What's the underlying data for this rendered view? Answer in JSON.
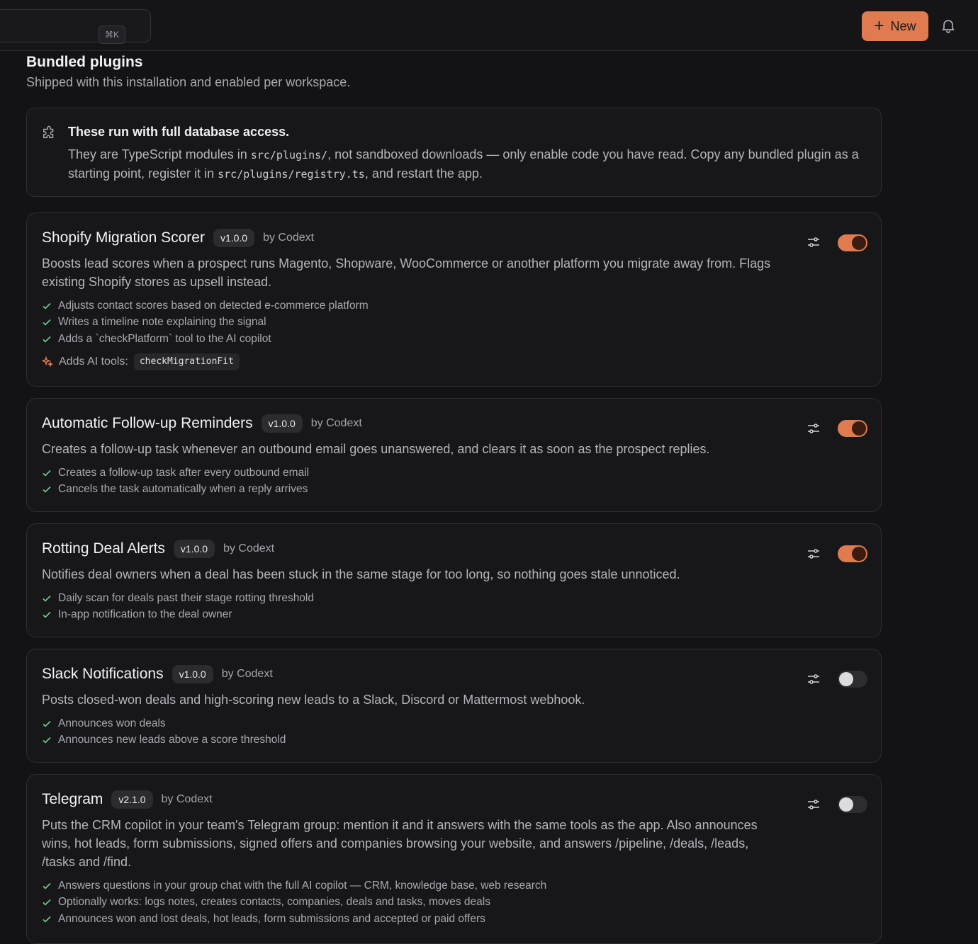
{
  "header": {
    "search_shortcut": "⌘K",
    "new_button_label": "New",
    "new_button_icon": "plus-icon",
    "notification_icon": "bell-icon",
    "accent_color": "#e07a4f"
  },
  "section": {
    "title": "Bundled plugins",
    "subtitle": "Shipped with this installation and enabled per workspace."
  },
  "notice": {
    "icon": "puzzle-icon",
    "title": "These run with full database access.",
    "body_1": "They are TypeScript modules in ",
    "code_1": "src/plugins/",
    "body_2": ", not sandboxed downloads — only enable code you have read. Copy any bundled plugin as a starting point, register it in ",
    "code_2": "src/plugins/registry.ts",
    "body_3": ", and restart the app."
  },
  "plugins": [
    {
      "name": "Shopify Migration Scorer",
      "version": "v1.0.0",
      "author": "by Codext",
      "enabled": true,
      "description": "Boosts lead scores when a prospect runs Magento, Shopware, WooCommerce or another platform you migrate away from. Flags existing Shopify stores as upsell instead.",
      "features": [
        "Adjusts contact scores based on detected e-commerce platform",
        "Writes a timeline note explaining the signal",
        "Adds a `checkPlatform` tool to the AI copilot"
      ],
      "tools_label": "Adds AI tools:",
      "tools": [
        "checkMigrationFit"
      ]
    },
    {
      "name": "Automatic Follow-up Reminders",
      "version": "v1.0.0",
      "author": "by Codext",
      "enabled": true,
      "description": "Creates a follow-up task whenever an outbound email goes unanswered, and clears it as soon as the prospect replies.",
      "features": [
        "Creates a follow-up task after every outbound email",
        "Cancels the task automatically when a reply arrives"
      ]
    },
    {
      "name": "Rotting Deal Alerts",
      "version": "v1.0.0",
      "author": "by Codext",
      "enabled": true,
      "description": "Notifies deal owners when a deal has been stuck in the same stage for too long, so nothing goes stale unnoticed.",
      "features": [
        "Daily scan for deals past their stage rotting threshold",
        "In-app notification to the deal owner"
      ]
    },
    {
      "name": "Slack Notifications",
      "version": "v1.0.0",
      "author": "by Codext",
      "enabled": false,
      "description": "Posts closed-won deals and high-scoring new leads to a Slack, Discord or Mattermost webhook.",
      "features": [
        "Announces won deals",
        "Announces new leads above a score threshold"
      ]
    },
    {
      "name": "Telegram",
      "version": "v2.1.0",
      "author": "by Codext",
      "enabled": false,
      "description": "Puts the CRM copilot in your team's Telegram group: mention it and it answers with the same tools as the app. Also announces wins, hot leads, form submissions, signed offers and companies browsing your website, and answers /pipeline, /deals, /leads, /tasks and /find.",
      "features": [
        "Answers questions in your group chat with the full AI copilot — CRM, knowledge base, web research",
        "Optionally works: logs notes, creates contacts, companies, deals and tasks, moves deals",
        "Announces won and lost deals, hot leads, form submissions and accepted or paid offers"
      ]
    }
  ]
}
